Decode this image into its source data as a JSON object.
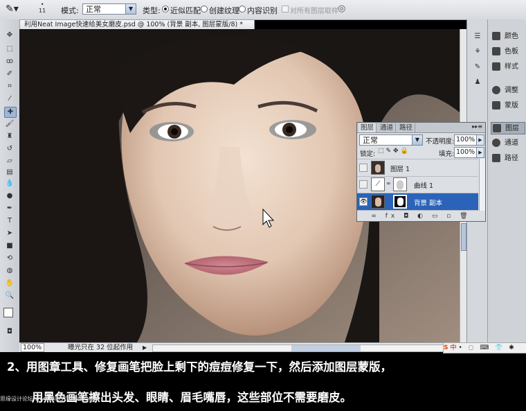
{
  "options_bar": {
    "brush_size": "11",
    "mode_label": "模式:",
    "mode_value": "正常",
    "type_label": "类型:",
    "type_options": [
      "近似匹配",
      "创建纹理",
      "内容识别"
    ],
    "selected_type": "近似匹配",
    "sample_all_layers": "对所有图层取样"
  },
  "document": {
    "tab_title": "利用Neat Image快速给美女磨皮.psd @ 100% (背景 副本, 图层蒙版/8) *",
    "zoom": "100%",
    "status_text": "曝光只在 32 位起作用"
  },
  "dock": {
    "panels_top": [
      "颜色",
      "色板",
      "样式"
    ],
    "panels_mid": [
      "调整",
      "蒙版"
    ],
    "panels_bottom": [
      "图层",
      "通道",
      "路径"
    ],
    "active": "图层"
  },
  "layers_panel": {
    "tabs": [
      "图层",
      "通道",
      "路径"
    ],
    "blend_mode": "正常",
    "opacity_label": "不透明度:",
    "opacity_value": "100%",
    "lock_label": "锁定:",
    "fill_label": "填充:",
    "fill_value": "100%",
    "layers": [
      {
        "name": "图层 1",
        "visible": false,
        "selected": false
      },
      {
        "name": "曲线 1",
        "visible": false,
        "selected": false
      },
      {
        "name": "背景 副本",
        "visible": true,
        "selected": true
      }
    ]
  },
  "caption": {
    "line1": "2、用图章工具、修复画笔把脸上剩下的痘痘修复一下，然后添加图层蒙版，",
    "line2": "用黑色画笔擦出头发、眼睛、眉毛嘴唇，这些部位不需要磨皮。",
    "watermark": "思缘设计论坛 www.MISSYUAN.COM"
  },
  "taskbar_ime": "中"
}
